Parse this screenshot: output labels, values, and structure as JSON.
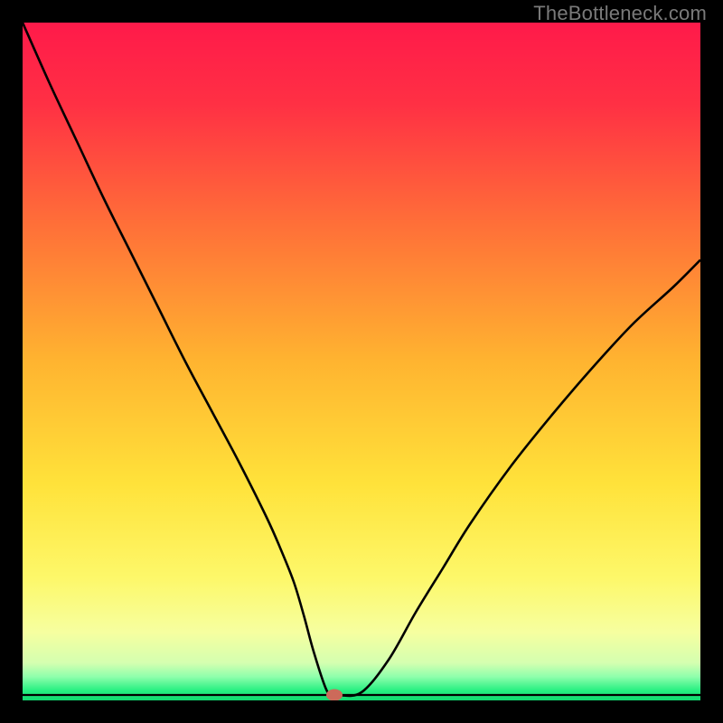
{
  "watermark": "TheBottleneck.com",
  "chart_data": {
    "type": "line",
    "title": "",
    "xlabel": "",
    "ylabel": "",
    "xlim": [
      0,
      100
    ],
    "ylim": [
      0,
      100
    ],
    "background_gradient": [
      {
        "stop": 0.0,
        "color": "#ff1a4a"
      },
      {
        "stop": 0.12,
        "color": "#ff3044"
      },
      {
        "stop": 0.3,
        "color": "#ff7038"
      },
      {
        "stop": 0.5,
        "color": "#ffb430"
      },
      {
        "stop": 0.68,
        "color": "#ffe23a"
      },
      {
        "stop": 0.82,
        "color": "#fdf86a"
      },
      {
        "stop": 0.9,
        "color": "#f6ffa0"
      },
      {
        "stop": 0.945,
        "color": "#d4ffb0"
      },
      {
        "stop": 0.965,
        "color": "#8fffac"
      },
      {
        "stop": 0.985,
        "color": "#28f082"
      },
      {
        "stop": 1.0,
        "color": "#10d86e"
      }
    ],
    "series": [
      {
        "name": "bottleneck-curve",
        "x": [
          0.0,
          4,
          8,
          12,
          16,
          20,
          24,
          28,
          32,
          36,
          38,
          40,
          41.5,
          43,
          45,
          46.5,
          50,
          54,
          58,
          62,
          66,
          72,
          78,
          84,
          90,
          96,
          100
        ],
        "values": [
          100,
          91,
          82.5,
          74,
          66,
          58,
          50,
          42.5,
          35,
          27,
          22.5,
          17.5,
          12.5,
          7,
          1.2,
          0.8,
          1.2,
          6,
          13,
          19.5,
          26,
          34.5,
          42,
          49,
          55.5,
          61,
          65
        ]
      }
    ],
    "marker": {
      "x": 46,
      "y": 0.8,
      "color": "#cc6a5a"
    },
    "baseline_y": 0.8
  }
}
